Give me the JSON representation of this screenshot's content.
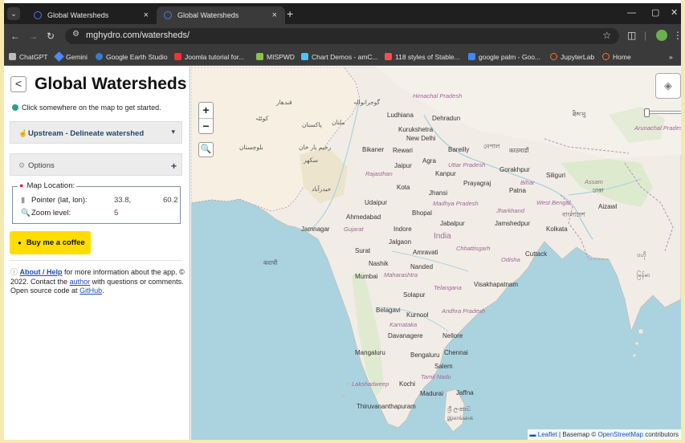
{
  "browser": {
    "tabs": [
      {
        "title": "Global Watersheds",
        "active": false
      },
      {
        "title": "Global Watersheds",
        "active": true
      }
    ],
    "close_glyph": "×",
    "new_tab_glyph": "+",
    "url": "mghydro.com/watersheds/",
    "bookmarks": [
      {
        "label": "ChatGPT",
        "color": "#bbbbbb"
      },
      {
        "label": "Gemini",
        "color": "#4a8af4"
      },
      {
        "label": "Google Earth Studio",
        "color": "#3a7bd5"
      },
      {
        "label": "Joomla tutorial for...",
        "color": "#e53935"
      },
      {
        "label": "MISPWD",
        "color": "#8bc34a"
      },
      {
        "label": "Chart Demos - amC...",
        "color": "#4fc3f7"
      },
      {
        "label": "118 styles of Stable...",
        "color": "#ef5350"
      },
      {
        "label": "google palm - Goo...",
        "color": "#4285f4"
      },
      {
        "label": "JupyterLab",
        "color": "#f37626"
      },
      {
        "label": "Home",
        "color": "#f37626"
      }
    ],
    "overflow_glyph": "»"
  },
  "sidebar": {
    "title": "Global Watersheds",
    "back_glyph": "<",
    "hint": "Click somewhere on the map to get started.",
    "mode_label": "Upstream - Delineate watershed",
    "options_label": "Options",
    "options_plus": "+",
    "map_location": {
      "legend": "Map Location:",
      "pointer_label": "Pointer (lat, lon):",
      "lat": "33.8,",
      "lon": "60.2",
      "zoom_label": "Zoom level:",
      "zoom_value": "5"
    },
    "coffee_label": "Buy me a coffee",
    "about": {
      "link1": "About / Help",
      "text1": " for more information about the app. © 2022. Contact the ",
      "link2": "author",
      "text2": " with questions or comments. Open source code at ",
      "link3": "GitHub",
      "text3": "."
    }
  },
  "map": {
    "zoom_in": "+",
    "zoom_out": "−",
    "attribution": {
      "leaflet": "Leaflet",
      "basemap": " | Basemap © ",
      "osm": "OpenStreetMap",
      "contrib": " contributors"
    },
    "labels": [
      {
        "text": "Himachal Pradesh",
        "cls": "state"
      },
      {
        "text": "Ludhiana",
        "cls": ""
      },
      {
        "text": "Dehradun",
        "cls": ""
      },
      {
        "text": "Kurukshetra",
        "cls": ""
      },
      {
        "text": "New Delhi",
        "cls": ""
      },
      {
        "text": "Bikaner",
        "cls": ""
      },
      {
        "text": "Rewari",
        "cls": ""
      },
      {
        "text": "Bareilly",
        "cls": ""
      },
      {
        "text": "Agra",
        "cls": ""
      },
      {
        "text": "Jaipur",
        "cls": ""
      },
      {
        "text": "Uttar Pradesh",
        "cls": "state"
      },
      {
        "text": "Gorakhpur",
        "cls": ""
      },
      {
        "text": "Siliguri",
        "cls": ""
      },
      {
        "text": "Rajasthan",
        "cls": "state"
      },
      {
        "text": "Kanpur",
        "cls": ""
      },
      {
        "text": "Prayagraj",
        "cls": ""
      },
      {
        "text": "Patna",
        "cls": ""
      },
      {
        "text": "Bihar",
        "cls": "state"
      },
      {
        "text": "Kota",
        "cls": ""
      },
      {
        "text": "Jhansi",
        "cls": ""
      },
      {
        "text": "Udaipur",
        "cls": ""
      },
      {
        "text": "Madhya Pradesh",
        "cls": "state"
      },
      {
        "text": "Bhopal",
        "cls": ""
      },
      {
        "text": "Jharkhand",
        "cls": "state"
      },
      {
        "text": "West Bengal",
        "cls": "state"
      },
      {
        "text": "Ahmedabad",
        "cls": ""
      },
      {
        "text": "Jabalpur",
        "cls": ""
      },
      {
        "text": "Jamshedpur",
        "cls": ""
      },
      {
        "text": "Kolkata",
        "cls": ""
      },
      {
        "text": "Jamnagar",
        "cls": ""
      },
      {
        "text": "Gujarat",
        "cls": "state"
      },
      {
        "text": "Indore",
        "cls": ""
      },
      {
        "text": "India",
        "cls": "big"
      },
      {
        "text": "Jalgaon",
        "cls": ""
      },
      {
        "text": "Surat",
        "cls": ""
      },
      {
        "text": "Amravati",
        "cls": ""
      },
      {
        "text": "Chhattisgarh",
        "cls": "state"
      },
      {
        "text": "Cuttack",
        "cls": ""
      },
      {
        "text": "Odisha",
        "cls": "state"
      },
      {
        "text": "Nashik",
        "cls": ""
      },
      {
        "text": "Nanded",
        "cls": ""
      },
      {
        "text": "Mumbai",
        "cls": ""
      },
      {
        "text": "Maharashtra",
        "cls": "state"
      },
      {
        "text": "Telangana",
        "cls": "state"
      },
      {
        "text": "Visakhapatnam",
        "cls": ""
      },
      {
        "text": "Solapur",
        "cls": ""
      },
      {
        "text": "Belagavi",
        "cls": ""
      },
      {
        "text": "Kurnool",
        "cls": ""
      },
      {
        "text": "Andhra Pradesh",
        "cls": "state"
      },
      {
        "text": "Karnataka",
        "cls": "state"
      },
      {
        "text": "Davanagere",
        "cls": ""
      },
      {
        "text": "Nellore",
        "cls": ""
      },
      {
        "text": "Mangaluru",
        "cls": ""
      },
      {
        "text": "Bengaluru",
        "cls": ""
      },
      {
        "text": "Chennai",
        "cls": ""
      },
      {
        "text": "Salem",
        "cls": ""
      },
      {
        "text": "Tamil Nadu",
        "cls": "state"
      },
      {
        "text": "Lakshadweep",
        "cls": "state"
      },
      {
        "text": "Kochi",
        "cls": ""
      },
      {
        "text": "Madurai",
        "cls": ""
      },
      {
        "text": "Jaffna",
        "cls": ""
      },
      {
        "text": "Thiruvananthapuram",
        "cls": ""
      },
      {
        "text": "ශ්‍රී ලංකාව",
        "cls": "script"
      },
      {
        "text": "இலங்கை",
        "cls": "script"
      },
      {
        "text": "Arunachal Pradesh",
        "cls": "state"
      },
      {
        "text": "Assam",
        "cls": "state"
      },
      {
        "text": "Aizawl",
        "cls": ""
      },
      {
        "text": "নেপাল",
        "cls": "script"
      },
      {
        "text": "काठमाडौं",
        "cls": "script"
      },
      {
        "text": "বাংলাদেশ",
        "cls": "script"
      },
      {
        "text": "ঢাকা",
        "cls": "script"
      },
      {
        "text": "कराची",
        "cls": "script"
      },
      {
        "text": "پاکستان",
        "cls": "script"
      },
      {
        "text": "ملتان",
        "cls": "script"
      },
      {
        "text": "کوئٹہ",
        "cls": "script"
      },
      {
        "text": "حیدرآباد",
        "cls": "script"
      },
      {
        "text": "سکھر",
        "cls": "script"
      },
      {
        "text": "بلوچستان",
        "cls": "script"
      },
      {
        "text": "رحیم یار خان",
        "cls": "script"
      },
      {
        "text": "گوجرانوالہ",
        "cls": "script"
      },
      {
        "text": "قندهار",
        "cls": "script"
      },
      {
        "text": "ཐིམ་ཕུ",
        "cls": "script"
      },
      {
        "text": "မြန်မာ",
        "cls": "script"
      },
      {
        "text": "ဗဟို",
        "cls": "script"
      }
    ]
  }
}
